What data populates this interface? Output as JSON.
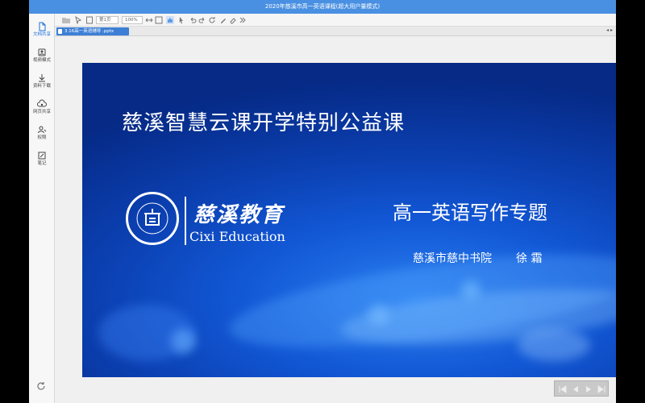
{
  "window": {
    "title": "2020年慈溪市高一英语课程(超大用户量模式)"
  },
  "sidebar": {
    "items": [
      {
        "label": "文档共享",
        "icon": "document-icon",
        "active": true
      },
      {
        "label": "视频模式",
        "icon": "video-mode-icon",
        "active": false
      },
      {
        "label": "资料下载",
        "icon": "download-icon",
        "active": false
      },
      {
        "label": "网页共享",
        "icon": "web-share-icon",
        "active": false
      },
      {
        "label": "权限",
        "icon": "permission-icon",
        "active": false
      },
      {
        "label": "笔记",
        "icon": "note-icon",
        "active": false
      }
    ],
    "refresh_icon": "refresh-icon"
  },
  "toolbar": {
    "page_select": "第1页",
    "zoom_select": "100%"
  },
  "tabs": {
    "active_tab": "3.16高一英语辅导 .pptx",
    "nav_arrows": "◂ ▸"
  },
  "slide": {
    "title": "慈溪智慧云课开学特别公益课",
    "logo_cn": "慈溪教育",
    "logo_en": "Cixi Education",
    "logo_ring_text": "CIXI EDUCATION",
    "logo_bottom_text": "慈溪教育",
    "subtitle": "高一英语写作专题",
    "school": "慈溪市慈中书院",
    "teacher": "徐 霜"
  },
  "colors": {
    "titlebar": "#4a90e2",
    "accent": "#1e6fd9",
    "slide_dark": "#062a86",
    "slide_light": "#2a7ff0"
  }
}
